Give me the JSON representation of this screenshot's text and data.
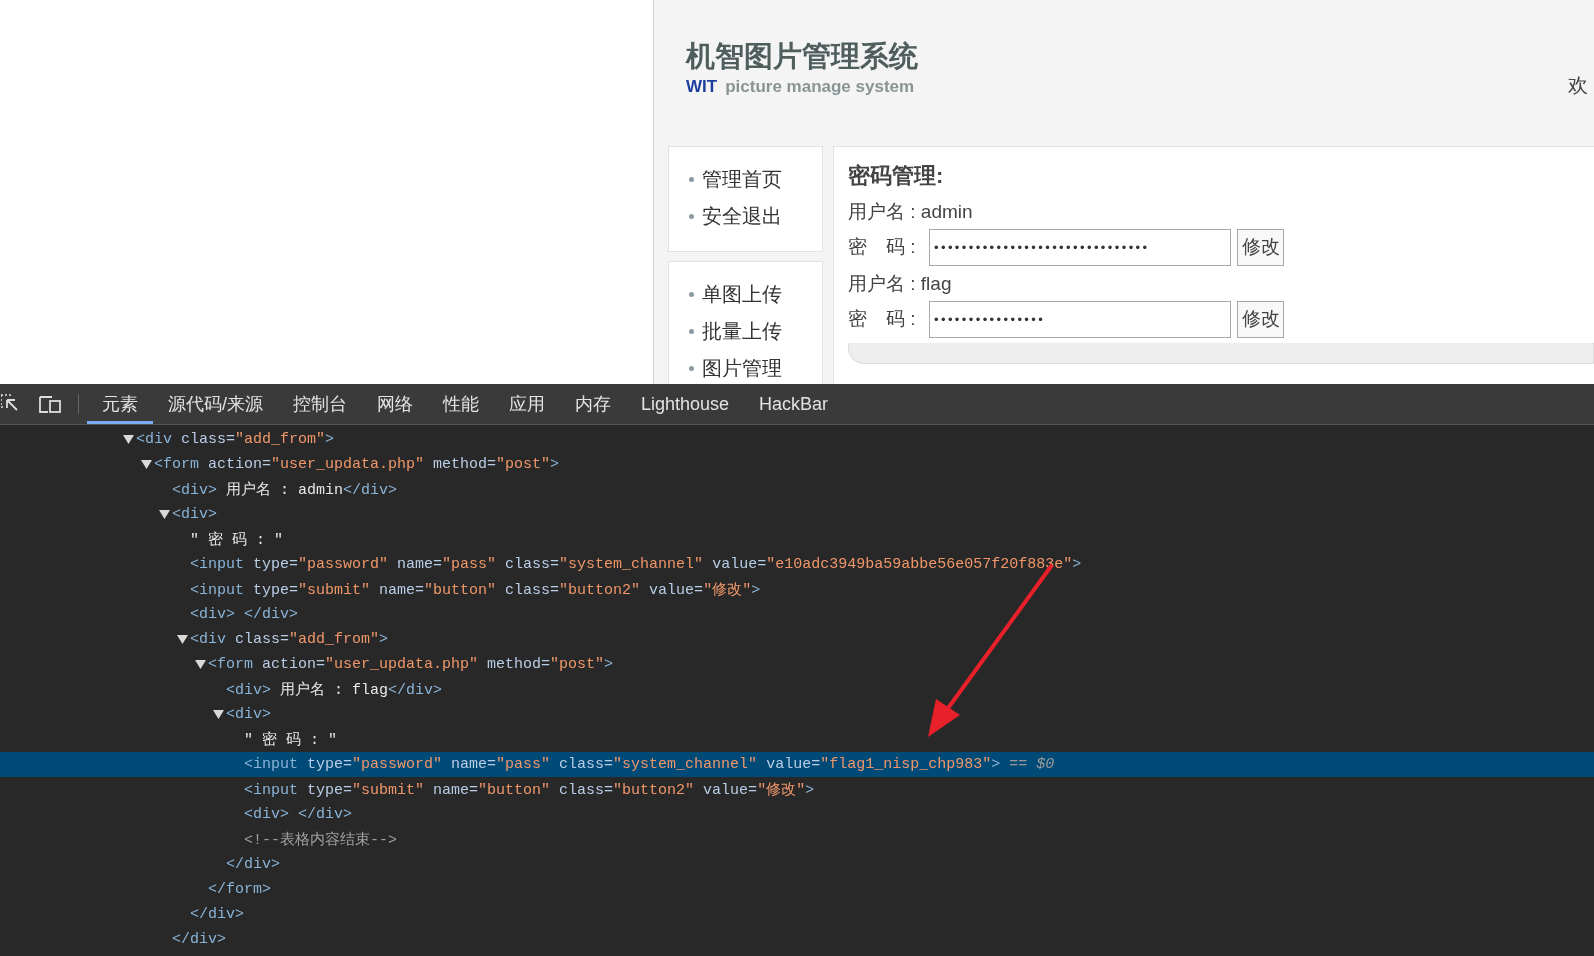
{
  "site": {
    "title": "机智图片管理系统",
    "brand": "WIT",
    "tagline": "picture manage system",
    "welcome": "欢",
    "menus": [
      {
        "items": [
          {
            "label": "管理首页"
          },
          {
            "label": "安全退出"
          }
        ]
      },
      {
        "items": [
          {
            "label": "单图上传"
          },
          {
            "label": "批量上传"
          },
          {
            "label": "图片管理"
          }
        ]
      }
    ],
    "panel": {
      "heading": "密码管理:",
      "accounts": [
        {
          "user": "用户名 : admin",
          "pass_label": "密　码 :",
          "value": "•••••••••••••••••••••••••••••••",
          "button": "修改"
        },
        {
          "user": "用户名 : flag",
          "pass_label": "密　码 :",
          "value": "••••••••••••••••",
          "button": "修改"
        }
      ]
    }
  },
  "devtools": {
    "tabs": [
      {
        "label": "元素",
        "selected": true
      },
      {
        "label": "源代码/来源",
        "selected": false
      },
      {
        "label": "控制台",
        "selected": false
      },
      {
        "label": "网络",
        "selected": false
      },
      {
        "label": "性能",
        "selected": false
      },
      {
        "label": "应用",
        "selected": false
      },
      {
        "label": "内存",
        "selected": false
      },
      {
        "label": "Lighthouse",
        "selected": false
      },
      {
        "label": "HackBar",
        "selected": false
      }
    ],
    "tree": [
      {
        "expanded": true,
        "selected": false,
        "tokens": [
          {
            "kind": "tag",
            "text": "<div "
          },
          {
            "kind": "attr",
            "text": "class="
          },
          {
            "kind": "value",
            "text": "\"add_from\""
          },
          {
            "kind": "tag",
            "text": ">"
          }
        ],
        "children": [
          {
            "expanded": true,
            "selected": false,
            "tokens": [
              {
                "kind": "tag",
                "text": "<form "
              },
              {
                "kind": "attr",
                "text": "action="
              },
              {
                "kind": "value",
                "text": "\"user_updata.php\""
              },
              {
                "kind": "attr",
                "text": " method="
              },
              {
                "kind": "value",
                "text": "\"post\""
              },
              {
                "kind": "tag",
                "text": ">"
              }
            ],
            "children": [
              {
                "selected": false,
                "tokens": [
                  {
                    "kind": "tag",
                    "text": "<div>"
                  },
                  {
                    "kind": "text",
                    "text": " 用户名 : admin"
                  },
                  {
                    "kind": "tag",
                    "text": "</div>"
                  }
                ]
              },
              {
                "expanded": true,
                "selected": false,
                "tokens": [
                  {
                    "kind": "tag",
                    "text": "<div>"
                  }
                ],
                "children": [
                  {
                    "selected": false,
                    "tokens": [
                      {
                        "kind": "text",
                        "text": "\" 密 码 : \""
                      }
                    ]
                  },
                  {
                    "selected": false,
                    "tokens": [
                      {
                        "kind": "tag",
                        "text": "<input "
                      },
                      {
                        "kind": "attr",
                        "text": "type="
                      },
                      {
                        "kind": "value",
                        "text": "\"password\""
                      },
                      {
                        "kind": "attr",
                        "text": " name="
                      },
                      {
                        "kind": "value",
                        "text": "\"pass\""
                      },
                      {
                        "kind": "attr",
                        "text": " class="
                      },
                      {
                        "kind": "value",
                        "text": "\"system_channel\""
                      },
                      {
                        "kind": "attr",
                        "text": " value="
                      },
                      {
                        "kind": "value",
                        "text": "\"e10adc3949ba59abbe56e057f20f883e\""
                      },
                      {
                        "kind": "tag",
                        "text": ">"
                      }
                    ]
                  },
                  {
                    "selected": false,
                    "tokens": [
                      {
                        "kind": "tag",
                        "text": "<input "
                      },
                      {
                        "kind": "attr",
                        "text": "type="
                      },
                      {
                        "kind": "value",
                        "text": "\"submit\""
                      },
                      {
                        "kind": "attr",
                        "text": " name="
                      },
                      {
                        "kind": "value",
                        "text": "\"button\""
                      },
                      {
                        "kind": "attr",
                        "text": " class="
                      },
                      {
                        "kind": "value",
                        "text": "\"button2\""
                      },
                      {
                        "kind": "attr",
                        "text": " value="
                      },
                      {
                        "kind": "value",
                        "text": "\"修改\""
                      },
                      {
                        "kind": "tag",
                        "text": ">"
                      }
                    ]
                  },
                  {
                    "selected": false,
                    "tokens": [
                      {
                        "kind": "tag",
                        "text": "<div> </div>"
                      }
                    ]
                  },
                  {
                    "expanded": true,
                    "selected": false,
                    "tokens": [
                      {
                        "kind": "tag",
                        "text": "<div "
                      },
                      {
                        "kind": "attr",
                        "text": "class="
                      },
                      {
                        "kind": "value",
                        "text": "\"add_from\""
                      },
                      {
                        "kind": "tag",
                        "text": ">"
                      }
                    ],
                    "children": [
                      {
                        "expanded": true,
                        "selected": false,
                        "tokens": [
                          {
                            "kind": "tag",
                            "text": "<form "
                          },
                          {
                            "kind": "attr",
                            "text": "action="
                          },
                          {
                            "kind": "value",
                            "text": "\"user_updata.php\""
                          },
                          {
                            "kind": "attr",
                            "text": " method="
                          },
                          {
                            "kind": "value",
                            "text": "\"post\""
                          },
                          {
                            "kind": "tag",
                            "text": ">"
                          }
                        ],
                        "children": [
                          {
                            "selected": false,
                            "tokens": [
                              {
                                "kind": "tag",
                                "text": "<div>"
                              },
                              {
                                "kind": "text",
                                "text": " 用户名 : flag"
                              },
                              {
                                "kind": "tag",
                                "text": "</div>"
                              }
                            ]
                          },
                          {
                            "expanded": true,
                            "selected": false,
                            "tokens": [
                              {
                                "kind": "tag",
                                "text": "<div>"
                              }
                            ],
                            "children": [
                              {
                                "selected": false,
                                "tokens": [
                                  {
                                    "kind": "text",
                                    "text": "\" 密 码 : \""
                                  }
                                ]
                              },
                              {
                                "selected": true,
                                "tokens": [
                                  {
                                    "kind": "tag",
                                    "text": "<input "
                                  },
                                  {
                                    "kind": "attr",
                                    "text": "type="
                                  },
                                  {
                                    "kind": "value",
                                    "text": "\"password\""
                                  },
                                  {
                                    "kind": "attr",
                                    "text": " name="
                                  },
                                  {
                                    "kind": "value",
                                    "text": "\"pass\""
                                  },
                                  {
                                    "kind": "attr",
                                    "text": " class="
                                  },
                                  {
                                    "kind": "value",
                                    "text": "\"system_channel\""
                                  },
                                  {
                                    "kind": "attr",
                                    "text": " value="
                                  },
                                  {
                                    "kind": "value",
                                    "text": "\"flag1_nisp_chp983\""
                                  },
                                  {
                                    "kind": "tag",
                                    "text": ">"
                                  },
                                  {
                                    "kind": "ref",
                                    "text": " == $0"
                                  }
                                ]
                              },
                              {
                                "selected": false,
                                "tokens": [
                                  {
                                    "kind": "tag",
                                    "text": "<input "
                                  },
                                  {
                                    "kind": "attr",
                                    "text": "type="
                                  },
                                  {
                                    "kind": "value",
                                    "text": "\"submit\""
                                  },
                                  {
                                    "kind": "attr",
                                    "text": " name="
                                  },
                                  {
                                    "kind": "value",
                                    "text": "\"button\""
                                  },
                                  {
                                    "kind": "attr",
                                    "text": " class="
                                  },
                                  {
                                    "kind": "value",
                                    "text": "\"button2\""
                                  },
                                  {
                                    "kind": "attr",
                                    "text": " value="
                                  },
                                  {
                                    "kind": "value",
                                    "text": "\"修改\""
                                  },
                                  {
                                    "kind": "tag",
                                    "text": ">"
                                  }
                                ]
                              },
                              {
                                "selected": false,
                                "tokens": [
                                  {
                                    "kind": "tag",
                                    "text": "<div> </div>"
                                  }
                                ]
                              },
                              {
                                "selected": false,
                                "tokens": [
                                  {
                                    "kind": "comment",
                                    "text": "<!--表格内容结束-->"
                                  }
                                ]
                              }
                            ],
                            "closing": [
                              {
                                "kind": "tag",
                                "text": "</div>"
                              }
                            ]
                          }
                        ],
                        "closing": [
                          {
                            "kind": "tag",
                            "text": "</form>"
                          }
                        ]
                      }
                    ],
                    "closing": [
                      {
                        "kind": "tag",
                        "text": "</div>"
                      }
                    ]
                  }
                ],
                "closing": [
                  {
                    "kind": "tag",
                    "text": "</div>"
                  }
                ]
              }
            ]
          }
        ]
      }
    ]
  }
}
